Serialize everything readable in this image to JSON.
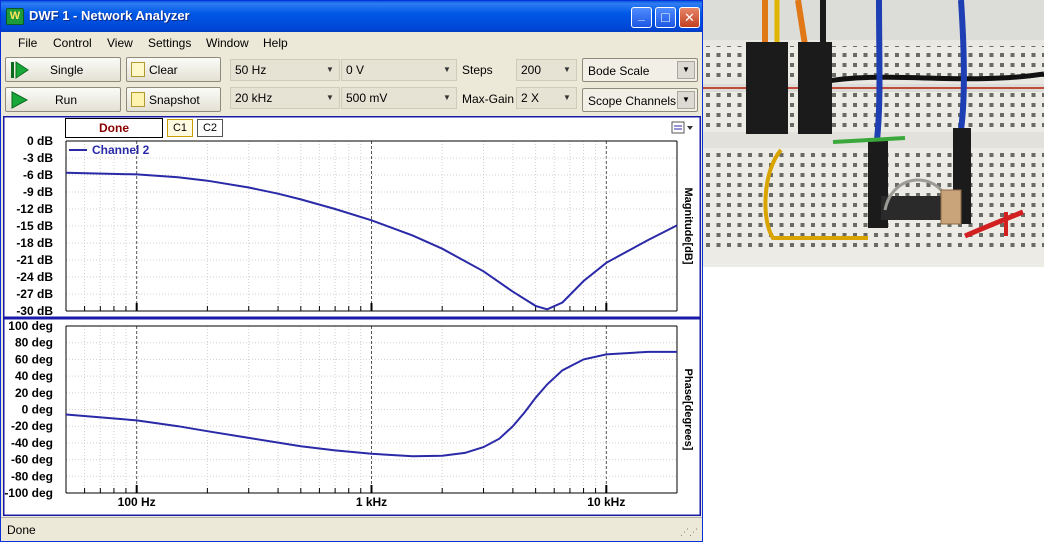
{
  "window": {
    "title": "DWF 1 - Network Analyzer",
    "logo_glyph": "W",
    "buttons": {
      "minimize": "_",
      "maximize": "□",
      "close": "✕"
    }
  },
  "menu": [
    "File",
    "Control",
    "View",
    "Settings",
    "Window",
    "Help"
  ],
  "toolbar": {
    "single_label": "Single",
    "run_label": "Run",
    "clear_label": "Clear",
    "snapshot_label": "Snapshot",
    "start_freq": "50 Hz",
    "stop_freq": "20 kHz",
    "offset": "0 V",
    "amplitude": "500 mV",
    "steps_label": "Steps",
    "steps_value": "200",
    "maxgain_label": "Max-Gain",
    "maxgain_value": "2 X",
    "bode_scale": "Bode Scale",
    "scope_channels": "Scope Channels"
  },
  "plot": {
    "status": "Done",
    "tab_c1": "C1",
    "tab_c2": "C2",
    "accent_color": "#2a2aa8",
    "grid_color": "#d0d0d0"
  },
  "status_bar": {
    "text": "Done"
  },
  "chart_data": [
    {
      "type": "line",
      "title": "",
      "xlabel": "",
      "ylabel": "Magnitude[dB]",
      "x_scale": "log",
      "x_ticks": [
        "100 Hz",
        "1 kHz",
        "10 kHz"
      ],
      "xlim": [
        50,
        20000
      ],
      "ylim": [
        -30,
        0
      ],
      "y_ticks": [
        "0 dB",
        "-3 dB",
        "-6 dB",
        "-9 dB",
        "-12 dB",
        "-15 dB",
        "-18 dB",
        "-21 dB",
        "-24 dB",
        "-27 dB",
        "-30 dB"
      ],
      "legend": "top-left",
      "grid": true,
      "series": [
        {
          "name": "Channel 2",
          "color": "#2a2aa8",
          "x": [
            50,
            100,
            150,
            200,
            300,
            400,
            500,
            700,
            1000,
            1500,
            2000,
            3000,
            4000,
            5000,
            5600,
            6500,
            8000,
            10000,
            15000,
            20000
          ],
          "y": [
            -5.6,
            -5.9,
            -6.4,
            -7.0,
            -8.2,
            -9.3,
            -10.3,
            -12.0,
            -14.0,
            -16.7,
            -19.0,
            -23.0,
            -26.6,
            -29.1,
            -29.7,
            -28.5,
            -24.7,
            -21.5,
            -17.5,
            -14.9
          ]
        }
      ]
    },
    {
      "type": "line",
      "title": "",
      "xlabel": "",
      "ylabel": "Phase[degrees]",
      "x_scale": "log",
      "x_ticks": [
        "100 Hz",
        "1 kHz",
        "10 kHz"
      ],
      "xlim": [
        50,
        20000
      ],
      "ylim": [
        -100,
        100
      ],
      "y_ticks": [
        "100 deg",
        "80 deg",
        "60 deg",
        "40 deg",
        "20 deg",
        "0 deg",
        "-20 deg",
        "-40 deg",
        "-60 deg",
        "-80 deg",
        "-100 deg"
      ],
      "grid": true,
      "series": [
        {
          "color": "#2a2aa8",
          "x": [
            50,
            100,
            150,
            200,
            300,
            500,
            700,
            1000,
            1500,
            2000,
            2500,
            3000,
            3500,
            4000,
            4500,
            5000,
            5600,
            6500,
            8000,
            10000,
            15000,
            20000
          ],
          "y": [
            -6,
            -13,
            -20,
            -26,
            -34,
            -44,
            -49,
            -53,
            -56,
            -55.5,
            -52,
            -45,
            -35,
            -20,
            -3,
            14,
            30,
            47,
            60,
            66,
            69,
            69
          ]
        }
      ]
    }
  ]
}
